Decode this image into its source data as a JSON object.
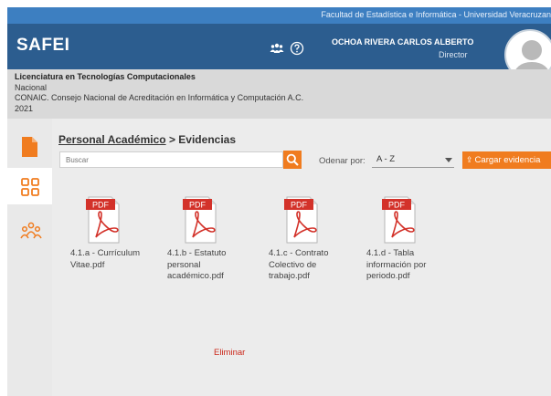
{
  "topbar": {
    "text": "Facultad de Estadística e Informática - Universidad Veracruzan"
  },
  "header": {
    "brand": "SAFEI",
    "icons": [
      "group-icon",
      "help-icon"
    ],
    "user_name": "OCHOA RIVERA CARLOS ALBERTO",
    "user_role": "Director"
  },
  "program": {
    "title": "Licenciatura en Tecnologías Computacionales",
    "scope": "Nacional",
    "accreditor": "CONAIC. Consejo Nacional de Acreditación en Informática y Computación A.C.",
    "year": "2021"
  },
  "sidebar": {
    "items": [
      {
        "icon": "document-icon",
        "active": false
      },
      {
        "icon": "grid-icon",
        "active": true
      },
      {
        "icon": "people-icon",
        "active": false
      }
    ]
  },
  "breadcrumb": {
    "section": "Personal Académico",
    "separator": " > ",
    "current": "Evidencias"
  },
  "search": {
    "placeholder": "Buscar"
  },
  "order": {
    "label": "Odenar por:",
    "value": "A - Z"
  },
  "upload": {
    "label": "Cargar evidencia"
  },
  "files": [
    {
      "icon_label": "PDF",
      "name": "4.1.a - Currículum Vitae.pdf"
    },
    {
      "icon_label": "PDF",
      "name": "4.1.b - Estatuto personal académico.pdf"
    },
    {
      "icon_label": "PDF",
      "name": "4.1.c - Contrato Colectivo de trabajo.pdf"
    },
    {
      "icon_label": "PDF",
      "name": "4.1.d - Tabla información por periodo.pdf"
    }
  ],
  "delete": {
    "label": "Eliminar"
  },
  "colors": {
    "topbar": "#3d7fc1",
    "header": "#2c5d8f",
    "accent": "#f07c1f",
    "pdf_red": "#d3322a",
    "delete": "#cc2a1d"
  }
}
